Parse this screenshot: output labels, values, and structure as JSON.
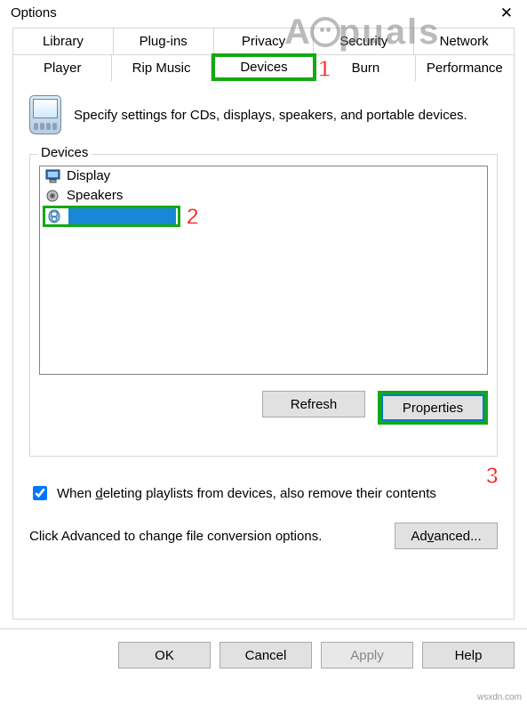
{
  "title": "Options",
  "tabs_row1": [
    {
      "label": "Library"
    },
    {
      "label": "Plug-ins"
    },
    {
      "label": "Privacy"
    },
    {
      "label": "Security"
    },
    {
      "label": "Network"
    }
  ],
  "tabs_row2": [
    {
      "label": "Player"
    },
    {
      "label": "Rip Music"
    },
    {
      "label": "Devices",
      "active": true
    },
    {
      "label": "Burn"
    },
    {
      "label": "Performance"
    }
  ],
  "intro_text": "Specify settings for CDs, displays, speakers, and portable devices.",
  "group_label": "Devices",
  "devices": [
    {
      "label": "Display",
      "icon": "monitor"
    },
    {
      "label": "Speakers",
      "icon": "speaker"
    },
    {
      "label": "",
      "icon": "player",
      "selected": true
    }
  ],
  "buttons": {
    "refresh": "Refresh",
    "properties": "Properties",
    "advanced": "Advanced...",
    "ok": "OK",
    "cancel": "Cancel",
    "apply": "Apply",
    "help": "Help"
  },
  "checkbox_label": "When deleting playlists from devices, also remove their contents",
  "checkbox_checked": true,
  "advanced_text": "Click Advanced to change file conversion options.",
  "annotations": {
    "a1": "1",
    "a2": "2",
    "a3": "3"
  },
  "watermark_text": "A puals",
  "source_note": "wsxdn.com"
}
